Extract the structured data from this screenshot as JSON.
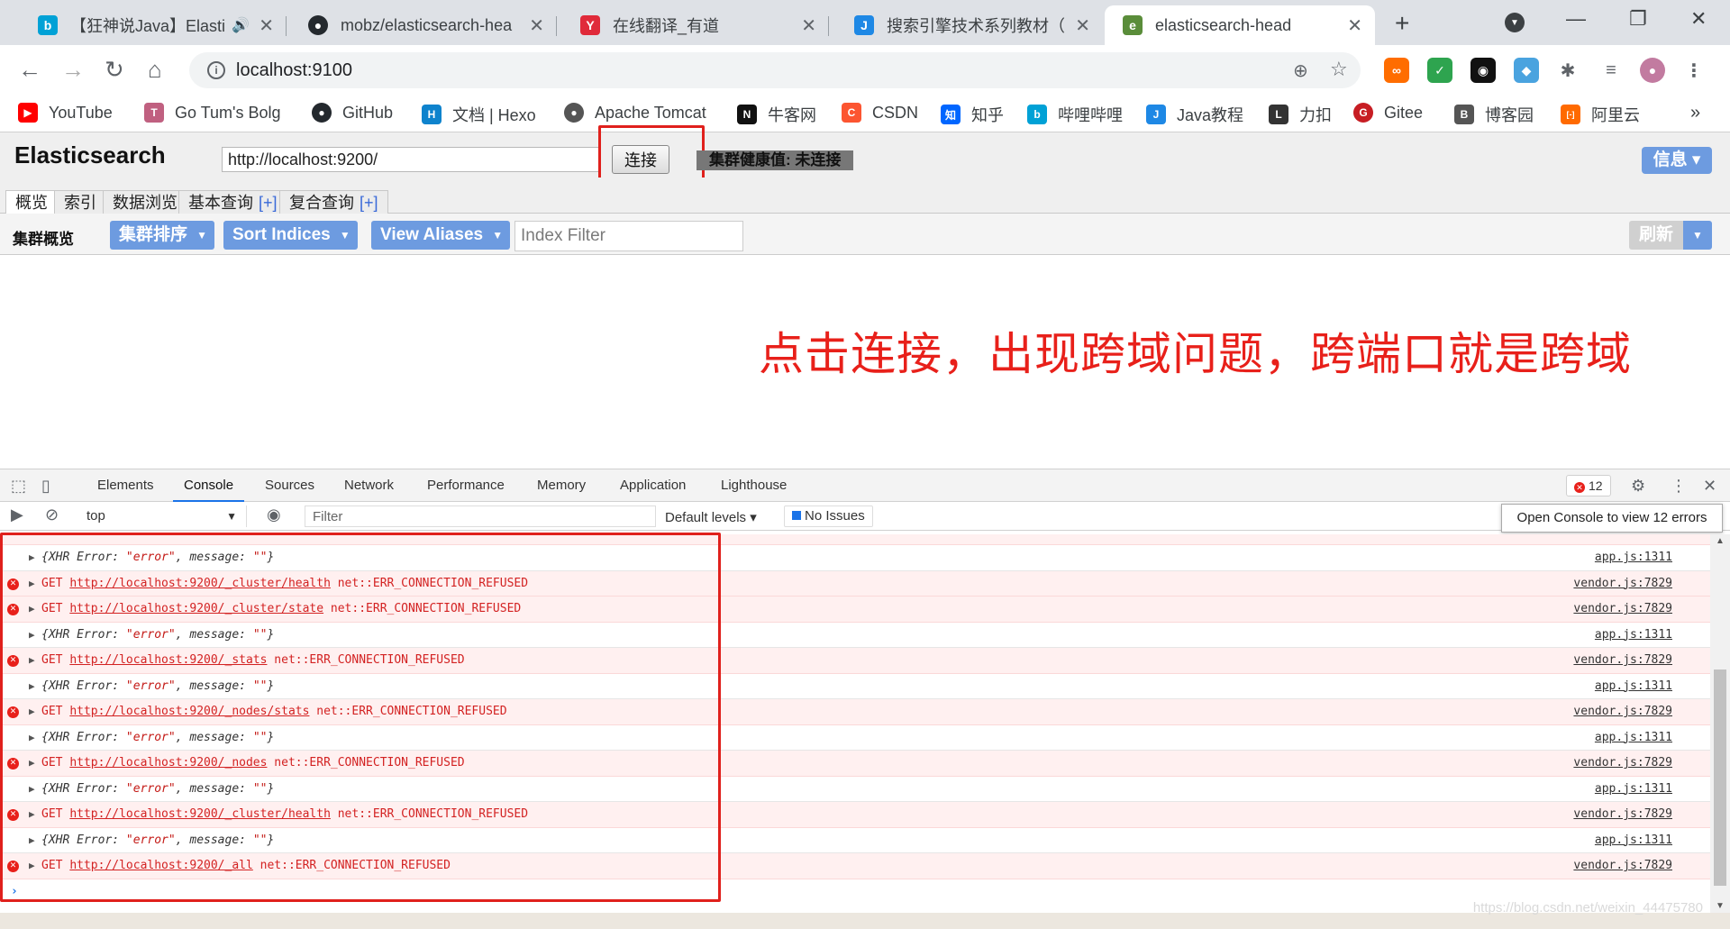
{
  "tabs": [
    {
      "title": "【狂神说Java】Elasti",
      "icon": "bilibili-icon",
      "color": "#00a1d6",
      "glyph": "📺",
      "audio": "🔊"
    },
    {
      "title": "mobz/elasticsearch-hea",
      "icon": "github-icon",
      "color": "#24292e",
      "glyph": "●"
    },
    {
      "title": "在线翻译_有道",
      "icon": "youdao-icon",
      "color": "#e02a3a",
      "glyph": "Y"
    },
    {
      "title": "搜索引擎技术系列教材（",
      "icon": "j-icon",
      "color": "#1e88e5",
      "glyph": "J"
    },
    {
      "title": "elasticsearch-head",
      "icon": "elasticsearch-head-icon",
      "color": "#5a8d3a",
      "glyph": "e"
    }
  ],
  "toolbar": {
    "url": "localhost:9100",
    "back": "←",
    "forward": "→",
    "reload": "↻",
    "home": "⌂"
  },
  "extensions": [
    {
      "name": "infinity-extension-icon",
      "color": "#ff6d00",
      "glyph": "∞"
    },
    {
      "name": "shield-extension-icon",
      "color": "#2ea44f",
      "glyph": "✓"
    },
    {
      "name": "game-extension-icon",
      "color": "#111111",
      "glyph": "◉"
    },
    {
      "name": "colorful-extension-icon",
      "color": "#4aa3df",
      "glyph": "◆"
    },
    {
      "name": "puzzle-extension-icon",
      "color": "#5f6368",
      "glyph": "✱"
    },
    {
      "name": "media-extension-icon",
      "color": "#5f6368",
      "glyph": "≡"
    },
    {
      "name": "profile-avatar-icon",
      "color": "#c27ba0",
      "glyph": "●"
    }
  ],
  "bookmarks": [
    {
      "label": "YouTube",
      "icon": "youtube-icon",
      "color": "#ff0000",
      "glyph": "▶"
    },
    {
      "label": "Go Tum's Bolg",
      "icon": "tum-icon",
      "color": "#c06080",
      "glyph": "T"
    },
    {
      "label": "GitHub",
      "icon": "github-icon",
      "color": "#24292e",
      "glyph": "●"
    },
    {
      "label": "文档 | Hexo",
      "icon": "hexo-icon",
      "color": "#0e83cd",
      "glyph": "H"
    },
    {
      "label": "Apache Tomcat",
      "icon": "tomcat-icon",
      "color": "#555555",
      "glyph": "●"
    },
    {
      "label": "牛客网",
      "icon": "nowcoder-icon",
      "color": "#111111",
      "glyph": "N"
    },
    {
      "label": "CSDN",
      "icon": "csdn-icon",
      "color": "#fc5531",
      "glyph": "C"
    },
    {
      "label": "知乎",
      "icon": "zhihu-icon",
      "color": "#0066ff",
      "glyph": "知"
    },
    {
      "label": "哔哩哔哩",
      "icon": "bilibili-icon",
      "color": "#00a1d6",
      "glyph": "b"
    },
    {
      "label": "Java教程",
      "icon": "java-icon",
      "color": "#1e88e5",
      "glyph": "J"
    },
    {
      "label": "力扣",
      "icon": "leetcode-icon",
      "color": "#333333",
      "glyph": "L"
    },
    {
      "label": "Gitee",
      "icon": "gitee-icon",
      "color": "#c71d23",
      "glyph": "G"
    },
    {
      "label": "博客园",
      "icon": "cnblogs-icon",
      "color": "#555555",
      "glyph": "B"
    },
    {
      "label": "阿里云",
      "icon": "aliyun-icon",
      "color": "#ff6a00",
      "glyph": "[-]"
    }
  ],
  "bookmarks_more": "»",
  "header": {
    "brand": "Elasticsearch",
    "uri": "http://localhost:9200/",
    "connect": "连接",
    "health": "集群健康值: 未连接",
    "info": "信息 ▾"
  },
  "page_tabs": [
    {
      "label": "概览",
      "plus": ""
    },
    {
      "label": "索引",
      "plus": ""
    },
    {
      "label": "数据浏览",
      "plus": ""
    },
    {
      "label": "基本查询",
      "plus": "[+]"
    },
    {
      "label": "复合查询",
      "plus": "[+]"
    }
  ],
  "overview": {
    "title": "集群概览",
    "sort_cluster": "集群排序",
    "sort_indices": "Sort Indices",
    "view_aliases": "View Aliases",
    "filter_placeholder": "Index Filter",
    "refresh": "刷新",
    "caret": "▼"
  },
  "annotation": "点击连接，出现跨域问题，跨端口就是跨域",
  "devtools": {
    "tabs": [
      "Elements",
      "Console",
      "Sources",
      "Network",
      "Performance",
      "Memory",
      "Application",
      "Lighthouse"
    ],
    "active_tab": "Console",
    "error_count": "12",
    "context": "top",
    "filter_placeholder": "Filter",
    "levels": "Default levels ▾",
    "issues": "No Issues",
    "tooltip": "Open Console to view 12 errors",
    "lines": [
      {
        "type": "obj",
        "text": "{XHR Error: ",
        "s1": "\"error\"",
        "mid": ", message: ",
        "s2": "\"\"",
        "end": "}",
        "src": "app.js:1311"
      },
      {
        "type": "err",
        "method": "GET ",
        "url": "http://localhost:9200/_cluster/health",
        "tail": " net::ERR_CONNECTION_REFUSED",
        "src": "vendor.js:7829"
      },
      {
        "type": "err",
        "method": "GET ",
        "url": "http://localhost:9200/_cluster/state",
        "tail": " net::ERR_CONNECTION_REFUSED",
        "src": "vendor.js:7829"
      },
      {
        "type": "obj",
        "text": "{XHR Error: ",
        "s1": "\"error\"",
        "mid": ", message: ",
        "s2": "\"\"",
        "end": "}",
        "src": "app.js:1311"
      },
      {
        "type": "err",
        "method": "GET ",
        "url": "http://localhost:9200/_stats",
        "tail": " net::ERR_CONNECTION_REFUSED",
        "src": "vendor.js:7829"
      },
      {
        "type": "obj",
        "text": "{XHR Error: ",
        "s1": "\"error\"",
        "mid": ", message: ",
        "s2": "\"\"",
        "end": "}",
        "src": "app.js:1311"
      },
      {
        "type": "err",
        "method": "GET ",
        "url": "http://localhost:9200/_nodes/stats",
        "tail": " net::ERR_CONNECTION_REFUSED",
        "src": "vendor.js:7829"
      },
      {
        "type": "obj",
        "text": "{XHR Error: ",
        "s1": "\"error\"",
        "mid": ", message: ",
        "s2": "\"\"",
        "end": "}",
        "src": "app.js:1311"
      },
      {
        "type": "err",
        "method": "GET ",
        "url": "http://localhost:9200/_nodes",
        "tail": " net::ERR_CONNECTION_REFUSED",
        "src": "vendor.js:7829"
      },
      {
        "type": "obj",
        "text": "{XHR Error: ",
        "s1": "\"error\"",
        "mid": ", message: ",
        "s2": "\"\"",
        "end": "}",
        "src": "app.js:1311"
      },
      {
        "type": "err",
        "method": "GET ",
        "url": "http://localhost:9200/_cluster/health",
        "tail": " net::ERR_CONNECTION_REFUSED",
        "src": "vendor.js:7829"
      },
      {
        "type": "obj",
        "text": "{XHR Error: ",
        "s1": "\"error\"",
        "mid": ", message: ",
        "s2": "\"\"",
        "end": "}",
        "src": "app.js:1311"
      },
      {
        "type": "err",
        "method": "GET ",
        "url": "http://localhost:9200/_all",
        "tail": " net::ERR_CONNECTION_REFUSED",
        "src": "vendor.js:7829"
      }
    ],
    "prompt": "›"
  },
  "watermark": "https://blog.csdn.net/weixin_44475780",
  "colors": {
    "accent": "#6d9be0",
    "error": "#e8201a",
    "annotation_red": "#e0201c"
  }
}
